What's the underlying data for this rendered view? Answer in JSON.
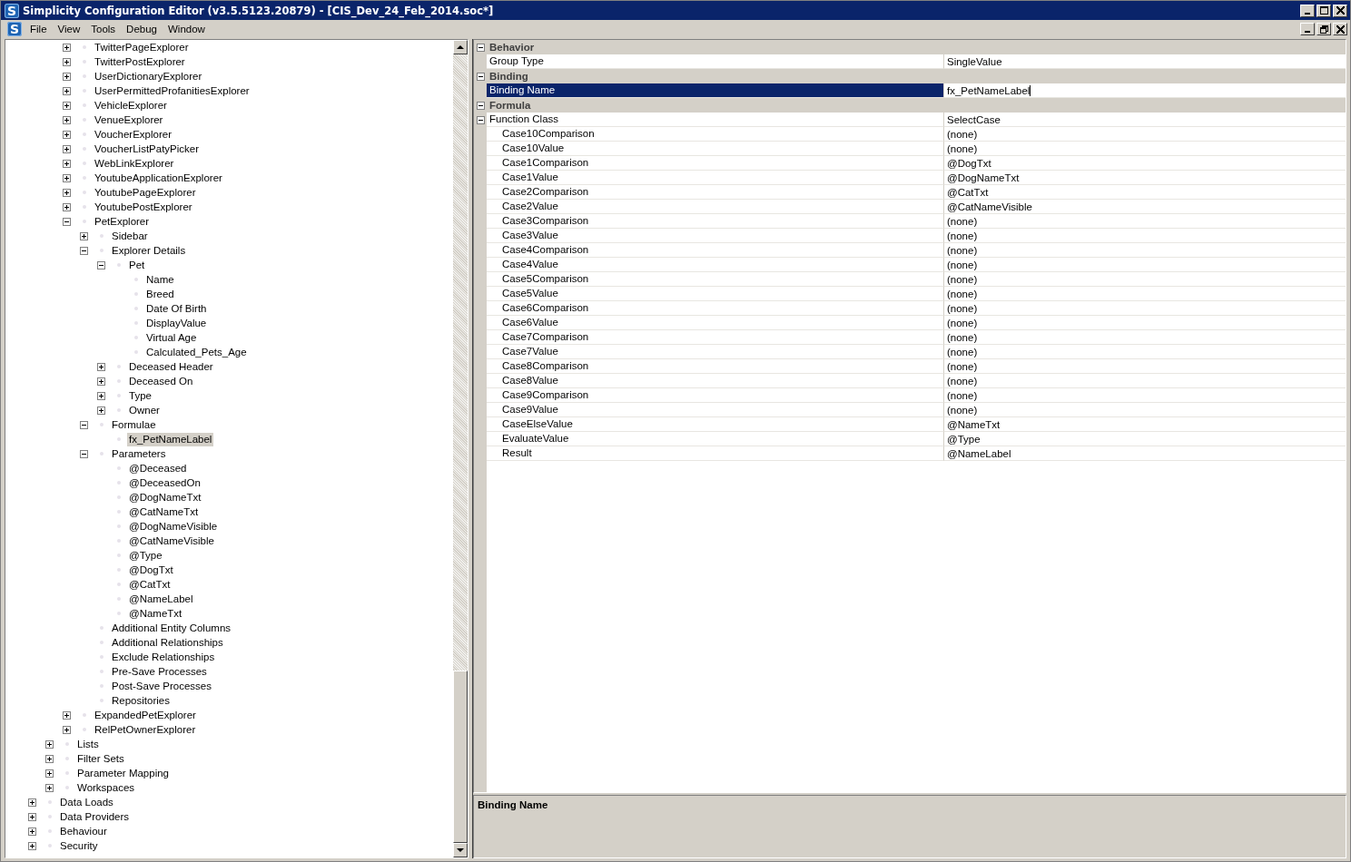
{
  "window": {
    "logo_letter": "S",
    "title": "Simplicity Configuration Editor (v3.5.5123.20879) - [CIS_Dev_24_Feb_2014.soc*]"
  },
  "menu_bar": {
    "logo_letter": "S",
    "items": [
      "File",
      "View",
      "Tools",
      "Debug",
      "Window"
    ]
  },
  "tree": {
    "items": [
      {
        "kind": "offscreen",
        "children": [
          {
            "kind": "offscreen",
            "children": [
              {
                "label": "TwitterPageExplorer",
                "kind": "node",
                "expanded": false,
                "selected": false
              },
              {
                "label": "TwitterPostExplorer",
                "kind": "node",
                "expanded": false,
                "selected": false
              },
              {
                "label": "UserDictionaryExplorer",
                "kind": "node",
                "expanded": false,
                "selected": false
              },
              {
                "label": "UserPermittedProfanitiesExplorer",
                "kind": "node",
                "expanded": false,
                "selected": false
              },
              {
                "label": "VehicleExplorer",
                "kind": "node",
                "expanded": false,
                "selected": false
              },
              {
                "label": "VenueExplorer",
                "kind": "node",
                "expanded": false,
                "selected": false
              },
              {
                "label": "VoucherExplorer",
                "kind": "node",
                "expanded": false,
                "selected": false
              },
              {
                "label": "VoucherListPatyPicker",
                "kind": "node",
                "expanded": false,
                "selected": false
              },
              {
                "label": "WebLinkExplorer",
                "kind": "node",
                "expanded": false,
                "selected": false
              },
              {
                "label": "YoutubeApplicationExplorer",
                "kind": "node",
                "expanded": false,
                "selected": false
              },
              {
                "label": "YoutubePageExplorer",
                "kind": "node",
                "expanded": false,
                "selected": false
              },
              {
                "label": "YoutubePostExplorer",
                "kind": "node",
                "expanded": false,
                "selected": false
              },
              {
                "label": "PetExplorer",
                "kind": "node",
                "expanded": true,
                "selected": false,
                "children": [
                  {
                    "label": "Sidebar",
                    "kind": "node",
                    "expanded": false,
                    "selected": false
                  },
                  {
                    "label": "Explorer Details",
                    "kind": "node",
                    "expanded": true,
                    "selected": false,
                    "children": [
                      {
                        "label": "Pet",
                        "kind": "node",
                        "expanded": true,
                        "selected": false,
                        "children": [
                          {
                            "label": "Name",
                            "kind": "leaf",
                            "selected": false
                          },
                          {
                            "label": "Breed",
                            "kind": "leaf",
                            "selected": false
                          },
                          {
                            "label": "Date Of Birth",
                            "kind": "leaf",
                            "selected": false
                          },
                          {
                            "label": "DisplayValue",
                            "kind": "leaf",
                            "selected": false
                          },
                          {
                            "label": "Virtual Age",
                            "kind": "leaf",
                            "selected": false
                          },
                          {
                            "label": "Calculated_Pets_Age",
                            "kind": "leaf",
                            "selected": false
                          }
                        ]
                      },
                      {
                        "label": "Deceased Header",
                        "kind": "node",
                        "expanded": false,
                        "selected": false
                      },
                      {
                        "label": "Deceased On",
                        "kind": "node",
                        "expanded": false,
                        "selected": false
                      },
                      {
                        "label": "Type",
                        "kind": "node",
                        "expanded": false,
                        "selected": false
                      },
                      {
                        "label": "Owner",
                        "kind": "node",
                        "expanded": false,
                        "selected": false
                      }
                    ]
                  },
                  {
                    "label": "Formulae",
                    "kind": "node",
                    "expanded": true,
                    "selected": false,
                    "children": [
                      {
                        "label": "fx_PetNameLabel",
                        "kind": "leaf",
                        "selected": true
                      }
                    ]
                  },
                  {
                    "label": "Parameters",
                    "kind": "node",
                    "expanded": true,
                    "selected": false,
                    "children": [
                      {
                        "label": "@Deceased",
                        "kind": "leaf",
                        "selected": false
                      },
                      {
                        "label": "@DeceasedOn",
                        "kind": "leaf",
                        "selected": false
                      },
                      {
                        "label": "@DogNameTxt",
                        "kind": "leaf",
                        "selected": false
                      },
                      {
                        "label": "@CatNameTxt",
                        "kind": "leaf",
                        "selected": false
                      },
                      {
                        "label": "@DogNameVisible",
                        "kind": "leaf",
                        "selected": false
                      },
                      {
                        "label": "@CatNameVisible",
                        "kind": "leaf",
                        "selected": false
                      },
                      {
                        "label": "@Type",
                        "kind": "leaf",
                        "selected": false
                      },
                      {
                        "label": "@DogTxt",
                        "kind": "leaf",
                        "selected": false
                      },
                      {
                        "label": "@CatTxt",
                        "kind": "leaf",
                        "selected": false
                      },
                      {
                        "label": "@NameLabel",
                        "kind": "leaf",
                        "selected": false
                      },
                      {
                        "label": "@NameTxt",
                        "kind": "leaf",
                        "selected": false
                      }
                    ]
                  },
                  {
                    "label": "Additional Entity Columns",
                    "kind": "leaf",
                    "selected": false
                  },
                  {
                    "label": "Additional Relationships",
                    "kind": "leaf",
                    "selected": false
                  },
                  {
                    "label": "Exclude Relationships",
                    "kind": "leaf",
                    "selected": false
                  },
                  {
                    "label": "Pre-Save Processes",
                    "kind": "leaf",
                    "selected": false
                  },
                  {
                    "label": "Post-Save Processes",
                    "kind": "leaf",
                    "selected": false
                  },
                  {
                    "label": "Repositories",
                    "kind": "leaf",
                    "selected": false
                  }
                ]
              },
              {
                "label": "ExpandedPetExplorer",
                "kind": "node",
                "expanded": false,
                "selected": false
              },
              {
                "label": "RelPetOwnerExplorer",
                "kind": "node",
                "expanded": false,
                "selected": false
              }
            ]
          },
          {
            "label": "Lists",
            "kind": "node",
            "expanded": false,
            "selected": false
          },
          {
            "label": "Filter Sets",
            "kind": "node",
            "expanded": false,
            "selected": false
          },
          {
            "label": "Parameter Mapping",
            "kind": "node",
            "expanded": false,
            "selected": false
          },
          {
            "label": "Workspaces",
            "kind": "node",
            "expanded": false,
            "selected": false
          }
        ]
      },
      {
        "label": "Data Loads",
        "kind": "node",
        "expanded": false,
        "selected": false
      },
      {
        "label": "Data Providers",
        "kind": "node",
        "expanded": false,
        "selected": false
      },
      {
        "label": "Behaviour",
        "kind": "node",
        "expanded": false,
        "selected": false
      },
      {
        "label": "Security",
        "kind": "node",
        "expanded": false,
        "selected": false
      }
    ]
  },
  "property_grid": {
    "categories": [
      {
        "name": "Behavior",
        "expanded": true,
        "properties": [
          {
            "name": "Group Type",
            "value": "SingleValue",
            "selected": false
          }
        ]
      },
      {
        "name": "Binding",
        "expanded": true,
        "properties": [
          {
            "name": "Binding Name",
            "value": "fx_PetNameLabel",
            "selected": true
          }
        ]
      },
      {
        "name": "Formula",
        "expanded": true,
        "properties": [
          {
            "name": "Function Class",
            "value": "SelectCase",
            "selected": false,
            "expanded": true,
            "children": [
              {
                "name": "Case10Comparison",
                "value": "(none)",
                "selected": false
              },
              {
                "name": "Case10Value",
                "value": "(none)",
                "selected": false
              },
              {
                "name": "Case1Comparison",
                "value": "@DogTxt",
                "selected": false
              },
              {
                "name": "Case1Value",
                "value": "@DogNameTxt",
                "selected": false
              },
              {
                "name": "Case2Comparison",
                "value": "@CatTxt",
                "selected": false
              },
              {
                "name": "Case2Value",
                "value": "@CatNameVisible",
                "selected": false
              },
              {
                "name": "Case3Comparison",
                "value": "(none)",
                "selected": false
              },
              {
                "name": "Case3Value",
                "value": "(none)",
                "selected": false
              },
              {
                "name": "Case4Comparison",
                "value": "(none)",
                "selected": false
              },
              {
                "name": "Case4Value",
                "value": "(none)",
                "selected": false
              },
              {
                "name": "Case5Comparison",
                "value": "(none)",
                "selected": false
              },
              {
                "name": "Case5Value",
                "value": "(none)",
                "selected": false
              },
              {
                "name": "Case6Comparison",
                "value": "(none)",
                "selected": false
              },
              {
                "name": "Case6Value",
                "value": "(none)",
                "selected": false
              },
              {
                "name": "Case7Comparison",
                "value": "(none)",
                "selected": false
              },
              {
                "name": "Case7Value",
                "value": "(none)",
                "selected": false
              },
              {
                "name": "Case8Comparison",
                "value": "(none)",
                "selected": false
              },
              {
                "name": "Case8Value",
                "value": "(none)",
                "selected": false
              },
              {
                "name": "Case9Comparison",
                "value": "(none)",
                "selected": false
              },
              {
                "name": "Case9Value",
                "value": "(none)",
                "selected": false
              },
              {
                "name": "CaseElseValue",
                "value": "@NameTxt",
                "selected": false
              },
              {
                "name": "EvaluateValue",
                "value": "@Type",
                "selected": false
              },
              {
                "name": "Result",
                "value": "@NameLabel",
                "selected": false
              }
            ]
          }
        ]
      }
    ]
  },
  "description": {
    "title": "Binding Name"
  }
}
